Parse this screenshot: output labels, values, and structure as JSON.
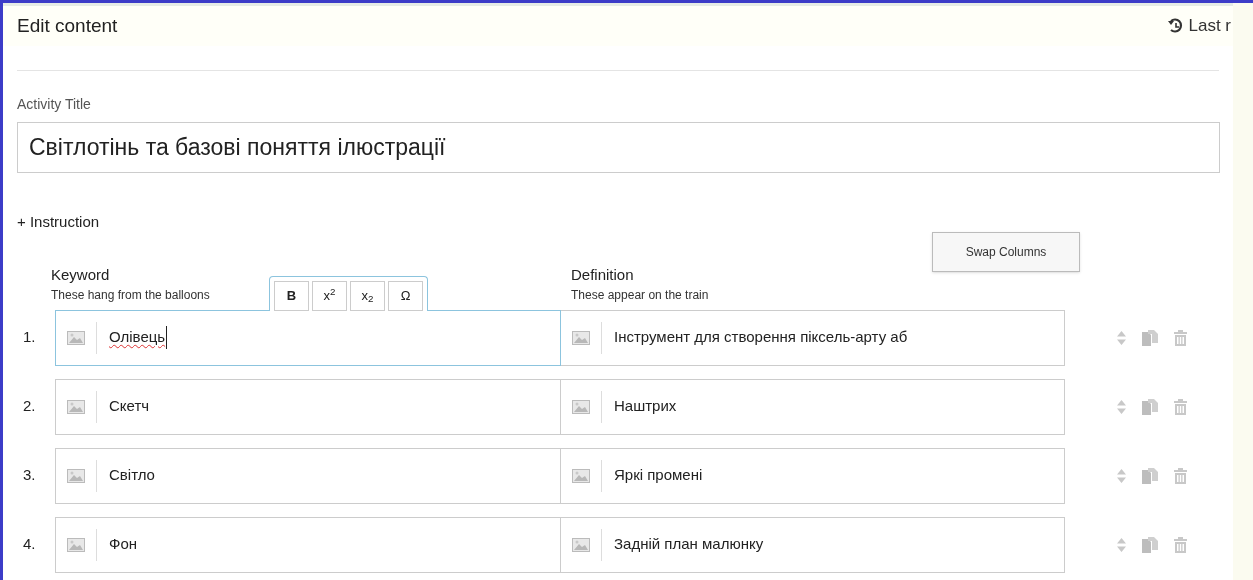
{
  "header": {
    "title": "Edit content",
    "last_saved": "Last r"
  },
  "activity_title": {
    "label": "Activity Title",
    "value": "Світлотінь та базові поняття ілюстрації"
  },
  "instruction_link": "+ Instruction",
  "swap_button": "Swap Columns",
  "columns": [
    {
      "title": "Keyword",
      "hint": "These hang from the balloons"
    },
    {
      "title": "Definition",
      "hint": "These appear on the train"
    }
  ],
  "format_toolbar": [
    "B",
    "x$^{2}$",
    "x$_{2}$",
    "Ω"
  ],
  "rows": [
    {
      "number": "1.",
      "keyword": "Олівець",
      "keyword_focused": true,
      "keyword_misspelled": true,
      "definition": "Інструмент для створення піксель-арту аб"
    },
    {
      "number": "2.",
      "keyword": "Скетч",
      "keyword_focused": false,
      "keyword_misspelled": false,
      "definition": "Наштрих"
    },
    {
      "number": "3.",
      "keyword": "Світло",
      "keyword_focused": false,
      "keyword_misspelled": false,
      "definition": "Яркі промені"
    },
    {
      "number": "4.",
      "keyword": "Фон",
      "keyword_focused": false,
      "keyword_misspelled": false,
      "definition": "Задній план малюнку"
    }
  ]
}
